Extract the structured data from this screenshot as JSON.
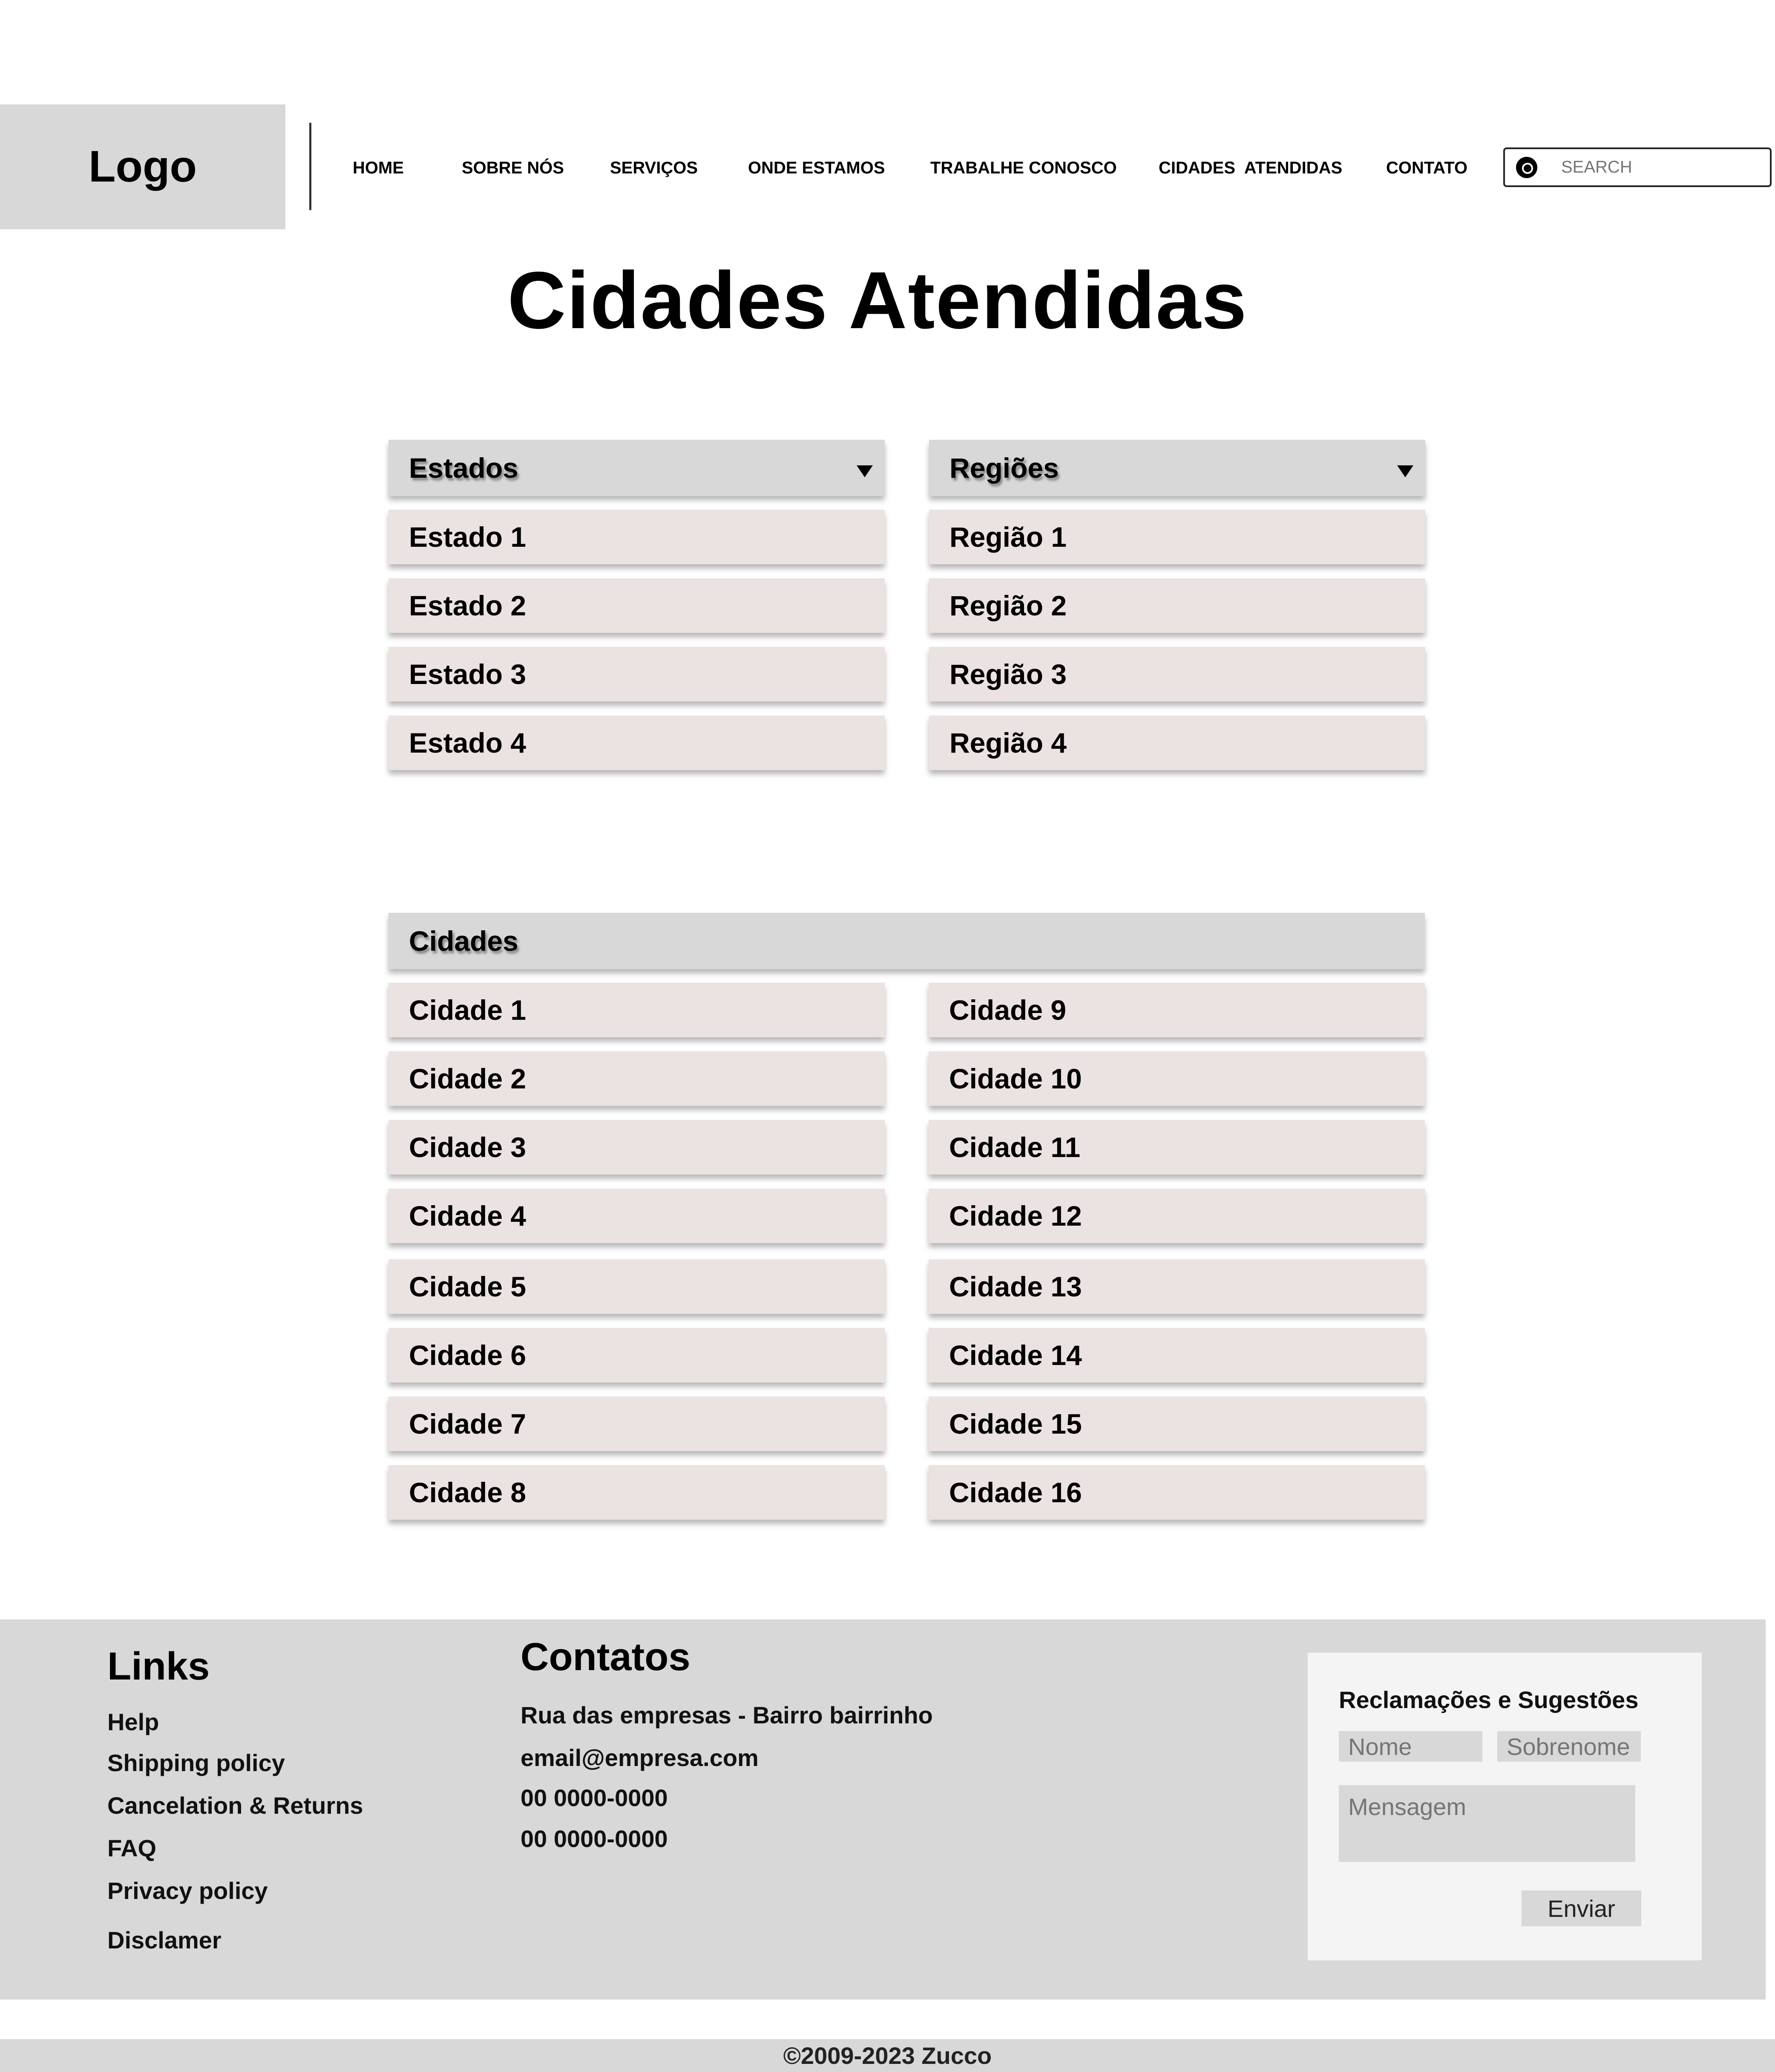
{
  "header": {
    "logo": "Logo",
    "nav": [
      "HOME",
      "SOBRE NÓS",
      "SERVIÇOS",
      "ONDE ESTAMOS",
      "TRABALHE CONOSCO",
      "CIDADES  ATENDIDAS",
      "CONTATO"
    ],
    "search_placeholder": "SEARCH",
    "search_icon": "compass-icon"
  },
  "page_title": "Cidades Atendidas",
  "estados": {
    "label": "Estados",
    "items": [
      "Estado 1",
      "Estado 2",
      "Estado 3",
      "Estado 4"
    ]
  },
  "regioes": {
    "label": "Regiões",
    "items": [
      "Região 1",
      "Região 2",
      "Região 3",
      "Região 4"
    ]
  },
  "cidades": {
    "label": "Cidades",
    "items": [
      "Cidade 1",
      "Cidade 2",
      "Cidade 3",
      "Cidade 4",
      "Cidade 5",
      "Cidade 6",
      "Cidade 7",
      "Cidade 8",
      "Cidade 9",
      "Cidade 10",
      "Cidade 11",
      "Cidade 12",
      "Cidade 13",
      "Cidade 14",
      "Cidade 15",
      "Cidade 16"
    ]
  },
  "footer": {
    "links_title": "Links",
    "links": [
      "Help",
      "Shipping policy",
      "Cancelation & Returns",
      "FAQ",
      "Privacy policy",
      "Disclamer"
    ],
    "contacts_title": "Contatos",
    "contacts": [
      "Rua das empresas - Bairro bairrinho",
      "email@empresa.com",
      "00 0000-0000",
      "00 0000-0000"
    ],
    "form": {
      "title": "Reclamações e Sugestões",
      "first_name_placeholder": "Nome",
      "last_name_placeholder": "Sobrenome",
      "message_placeholder": "Mensagem",
      "submit_label": "Enviar"
    },
    "copyright": "©2009-2023 Zucco"
  },
  "colors": {
    "panel_header": "#d8d8d8",
    "list_item": "#ebe2e2",
    "footer_bg": "#d8d8d8",
    "form_card": "#f4f4f4"
  }
}
